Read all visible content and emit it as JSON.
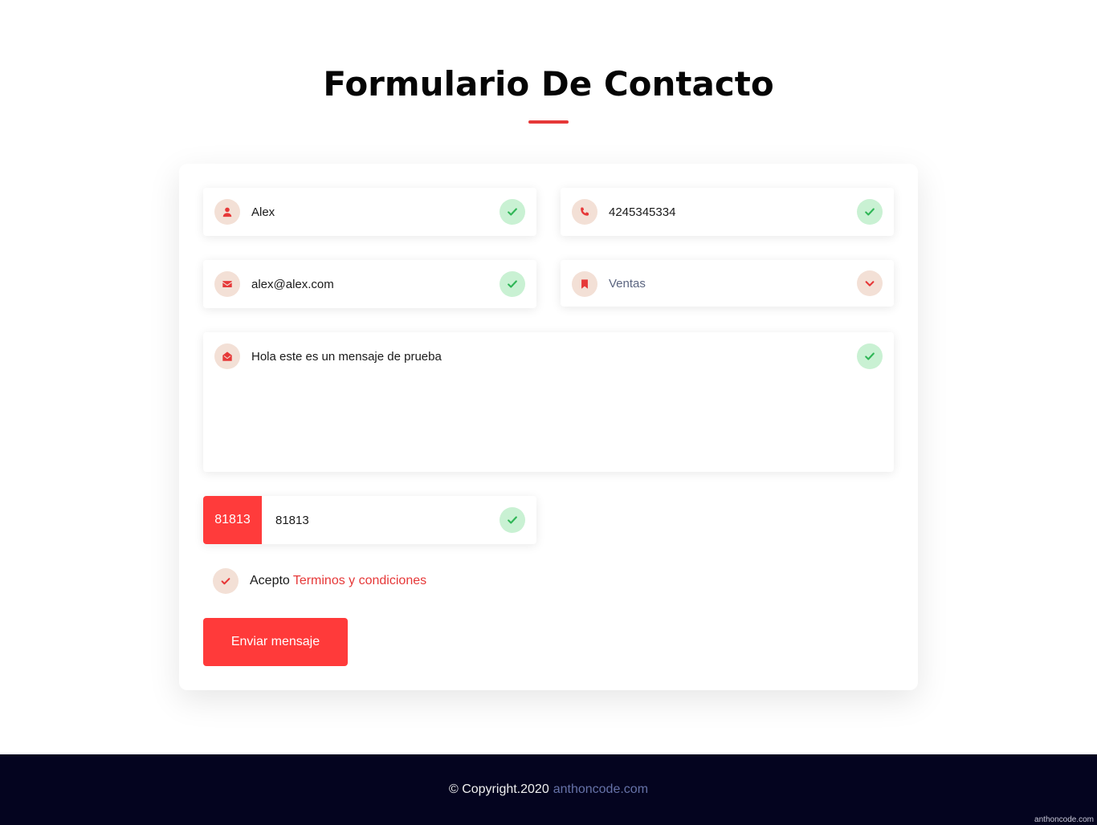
{
  "page": {
    "title": "Formulario De Contacto"
  },
  "form": {
    "name": {
      "value": "Alex"
    },
    "phone": {
      "value": "4245345334"
    },
    "email": {
      "value": "alex@alex.com"
    },
    "department": {
      "selected": "Ventas"
    },
    "message": {
      "value": "Hola este es un mensaje de prueba"
    },
    "captcha": {
      "code": "81813",
      "value": "81813"
    },
    "terms": {
      "label": "Acepto",
      "link_text": "Terminos y condiciones"
    },
    "submit_label": "Enviar mensaje"
  },
  "footer": {
    "copyright": "© Copyright.2020",
    "link_text": "anthoncode.com",
    "watermark": "anthoncode.com"
  },
  "colors": {
    "accent": "#ff3b3b",
    "icon_bg": "#f3e0d6",
    "success_bg": "#c9f1d3",
    "success": "#2fb656",
    "footer_bg": "#04041f"
  },
  "icons": {
    "name": "user-icon",
    "phone": "phone-icon",
    "email": "envelope-icon",
    "department": "bookmark-icon",
    "message": "envelope-open-icon",
    "valid": "check-icon",
    "select": "chevron-down-icon"
  }
}
